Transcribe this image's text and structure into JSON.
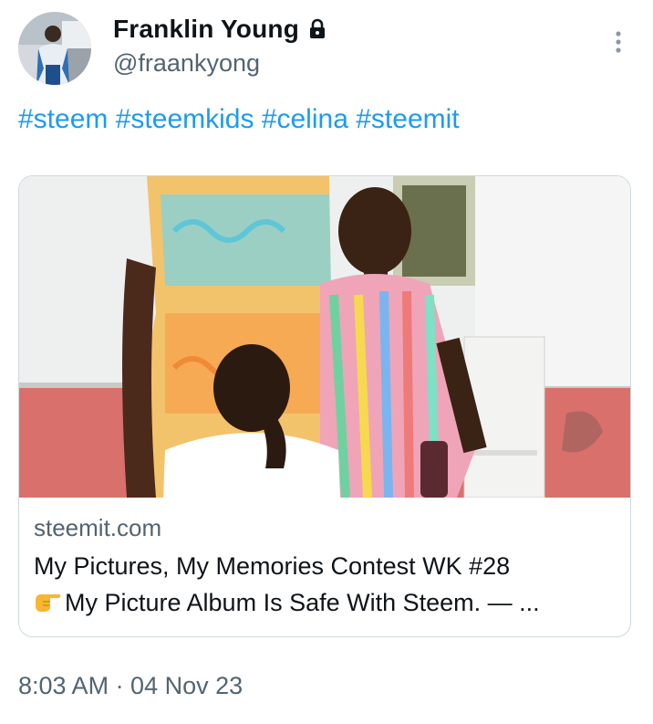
{
  "tweet": {
    "display_name": "Franklin Young",
    "handle": "@fraankyong",
    "protected_icon": "lock-icon",
    "more_icon": "more-vertical-icon",
    "hashtags": [
      "#steem",
      "#steemkids",
      "#celina",
      "#steemit"
    ],
    "link_card": {
      "domain": "steemit.com",
      "title_line1": "My Pictures, My Memories Contest WK #28",
      "title_line2": "My Picture Album Is Safe With Steem. — ...",
      "title_emoji": "backhand-index-pointing-right-icon"
    },
    "timestamp": "8:03 AM · 04 Nov 23"
  },
  "colors": {
    "accent": "#1d9bf0",
    "text_primary": "#0f1419",
    "text_secondary": "#536471",
    "border": "#cfd9de"
  }
}
